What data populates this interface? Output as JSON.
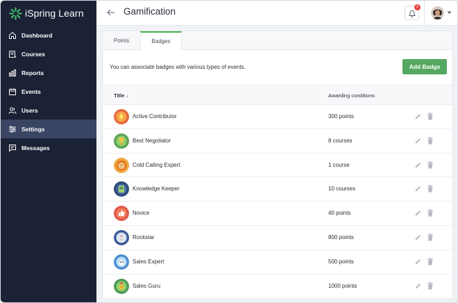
{
  "app": {
    "name": "iSpring Learn",
    "logo_icon": "ispring-logo-icon"
  },
  "sidebar": {
    "items": [
      {
        "label": "Dashboard",
        "icon": "home-icon",
        "active": false
      },
      {
        "label": "Courses",
        "icon": "courses-icon",
        "active": false
      },
      {
        "label": "Reports",
        "icon": "bar-chart-icon",
        "active": false
      },
      {
        "label": "Events",
        "icon": "calendar-icon",
        "active": false
      },
      {
        "label": "Users",
        "icon": "users-icon",
        "active": false
      },
      {
        "label": "Settings",
        "icon": "sliders-icon",
        "active": true
      },
      {
        "label": "Messages",
        "icon": "message-icon",
        "active": false
      }
    ]
  },
  "header": {
    "title": "Gamification",
    "notification_count": "2"
  },
  "tabs": [
    {
      "label": "Points",
      "active": false
    },
    {
      "label": "Badges",
      "active": true
    }
  ],
  "badges_panel": {
    "description": "You can associate badges with various types of events.",
    "add_button": "Add Badge",
    "columns": {
      "title": "Title",
      "sort_arrow": "↓",
      "conditions": "Awarding conditions"
    },
    "rows": [
      {
        "title": "Active Contributor",
        "condition": "300 points",
        "icon": "lightning-badge-icon"
      },
      {
        "title": "Best Negotiator",
        "condition": "8 courses",
        "icon": "trophy-badge-icon"
      },
      {
        "title": "Cold Calling Expert",
        "condition": "1 course",
        "icon": "lion-badge-icon"
      },
      {
        "title": "Knowledge Keeper",
        "condition": "10 courses",
        "icon": "book-badge-icon"
      },
      {
        "title": "Novice",
        "condition": "40 points",
        "icon": "thumbs-up-badge-icon"
      },
      {
        "title": "Rockstar",
        "condition": "800 points",
        "icon": "rocket-badge-icon"
      },
      {
        "title": "Sales Expert",
        "condition": "500 points",
        "icon": "owl-badge-icon"
      },
      {
        "title": "Sales Guru",
        "condition": "1000 points",
        "icon": "medal-badge-icon"
      }
    ]
  },
  "colors": {
    "sidebar_bg": "#1c2236",
    "sidebar_active": "#3a4563",
    "accent_green": "#55a860",
    "logo_green": "#3ec467"
  }
}
